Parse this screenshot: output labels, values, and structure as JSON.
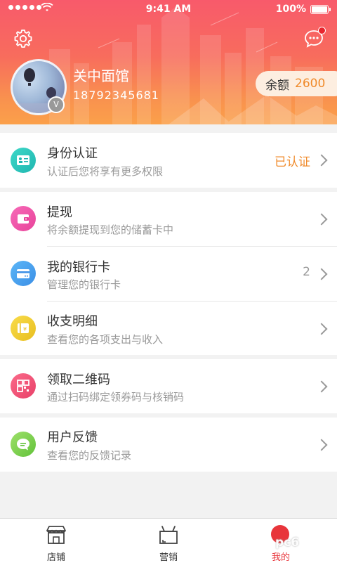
{
  "status_bar": {
    "time": "9:41 AM",
    "battery": "100%"
  },
  "colors": {
    "accent_orange": "#f08a2a",
    "header_top": "#f85a6b",
    "header_bottom": "#fba04a",
    "active_tab": "#e8353b"
  },
  "header": {
    "settings_icon": "gear-icon",
    "message_icon": "chat-bubble-icon",
    "avatar_badge": "V",
    "shop_name": "关中面馆",
    "phone": "18792345681",
    "balance_label": "余额",
    "balance_value": "2600"
  },
  "menu": [
    {
      "icon": "id-card-icon",
      "title": "身份认证",
      "subtitle": "认证后您将享有更多权限",
      "right_text": "已认证"
    },
    {
      "icon": "wallet-icon",
      "title": "提现",
      "subtitle": "将余额提现到您的储蓄卡中"
    },
    {
      "icon": "bank-card-icon",
      "title": "我的银行卡",
      "subtitle": "管理您的银行卡",
      "count": "2"
    },
    {
      "icon": "ledger-icon",
      "title": "收支明细",
      "subtitle": "查看您的各项支出与收入"
    },
    {
      "icon": "qrcode-icon",
      "title": "领取二维码",
      "subtitle": "通过扫码绑定领券码与核销码"
    },
    {
      "icon": "feedback-icon",
      "title": "用户反馈",
      "subtitle": "查看您的反馈记录"
    }
  ],
  "tabbar": {
    "tabs": [
      {
        "label": "店铺",
        "icon": "store-icon"
      },
      {
        "label": "营销",
        "icon": "gift-box-icon"
      },
      {
        "label": "我的",
        "icon": "profile-icon",
        "active": true
      }
    ]
  },
  "watermark": "pc6"
}
